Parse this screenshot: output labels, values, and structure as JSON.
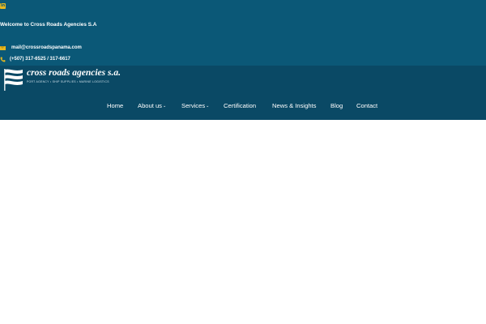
{
  "topbar": {
    "social": {
      "icon": "linkedin-icon",
      "glyph": "in"
    },
    "welcome": "Welcome to Cross Roads Agencies S.A",
    "email": {
      "icon": "mail-icon",
      "text": "mail@crossroadspanama.com"
    },
    "phone": {
      "icon": "phone-icon",
      "text": "(+507) 317-6525 / 317-6617"
    }
  },
  "logo": {
    "name": "cross roads agencies s.a.",
    "tagline": "PORT AGENCY  •  SHIP SUPPLIES  •  MARINE LOGISTICS"
  },
  "menu": [
    {
      "label": "Home",
      "has_dropdown": false
    },
    {
      "label": "About us",
      "has_dropdown": true
    },
    {
      "label": "Services",
      "has_dropdown": true
    },
    {
      "label": "Certification",
      "has_dropdown": false
    },
    {
      "label": "News & Insights",
      "has_dropdown": false
    },
    {
      "label": "Blog",
      "has_dropdown": false
    },
    {
      "label": "Contact",
      "has_dropdown": false
    }
  ],
  "colors": {
    "topbar_bg": "#0b5877",
    "navbar_bg": "#0a4965",
    "accent": "#e7b81f",
    "text": "#ffffff"
  }
}
